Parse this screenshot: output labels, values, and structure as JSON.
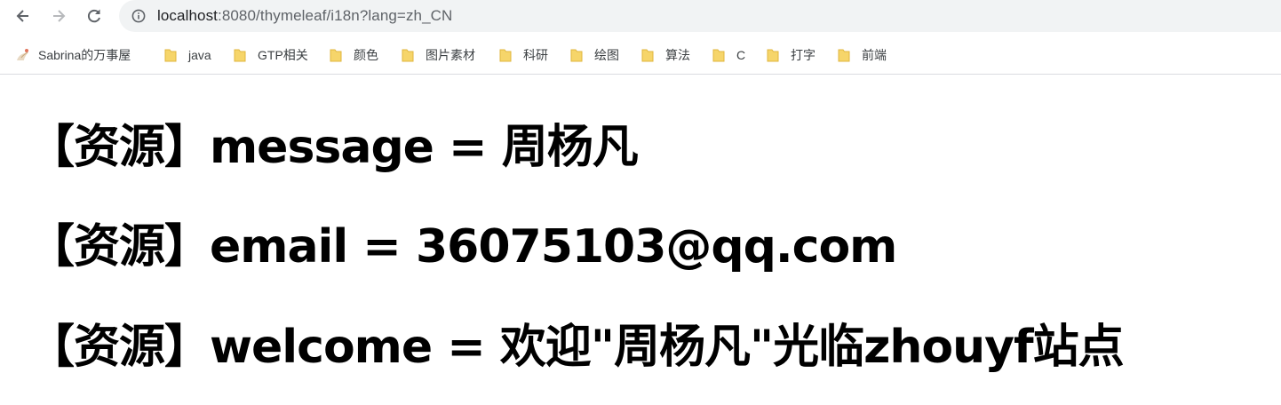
{
  "browser": {
    "url_host": "localhost",
    "url_rest": ":8080/thymeleaf/i18n?lang=zh_CN",
    "icons": {
      "back": "back-arrow-icon",
      "forward": "forward-arrow-icon",
      "reload": "reload-icon",
      "site_info": "info-icon"
    },
    "bookmarks": [
      {
        "label": "Sabrina的万事屋",
        "icon": "site-favicon-icon"
      },
      {
        "label": "java",
        "icon": "folder-icon"
      },
      {
        "label": "GTP相关",
        "icon": "folder-icon"
      },
      {
        "label": "颜色",
        "icon": "folder-icon"
      },
      {
        "label": "图片素材",
        "icon": "folder-icon"
      },
      {
        "label": "科研",
        "icon": "folder-icon"
      },
      {
        "label": "绘图",
        "icon": "folder-icon"
      },
      {
        "label": "算法",
        "icon": "folder-icon"
      },
      {
        "label": "C",
        "icon": "folder-icon"
      },
      {
        "label": "打字",
        "icon": "folder-icon"
      },
      {
        "label": "前端",
        "icon": "folder-icon"
      }
    ],
    "colors": {
      "folder": "#f6d56a",
      "omnibox": "#f1f3f4"
    }
  },
  "page": {
    "lines": [
      "【资源】message = 周杨凡",
      "【资源】email = 36075103@qq.com",
      "【资源】welcome = 欢迎\"周杨凡\"光临zhouyf站点"
    ]
  }
}
